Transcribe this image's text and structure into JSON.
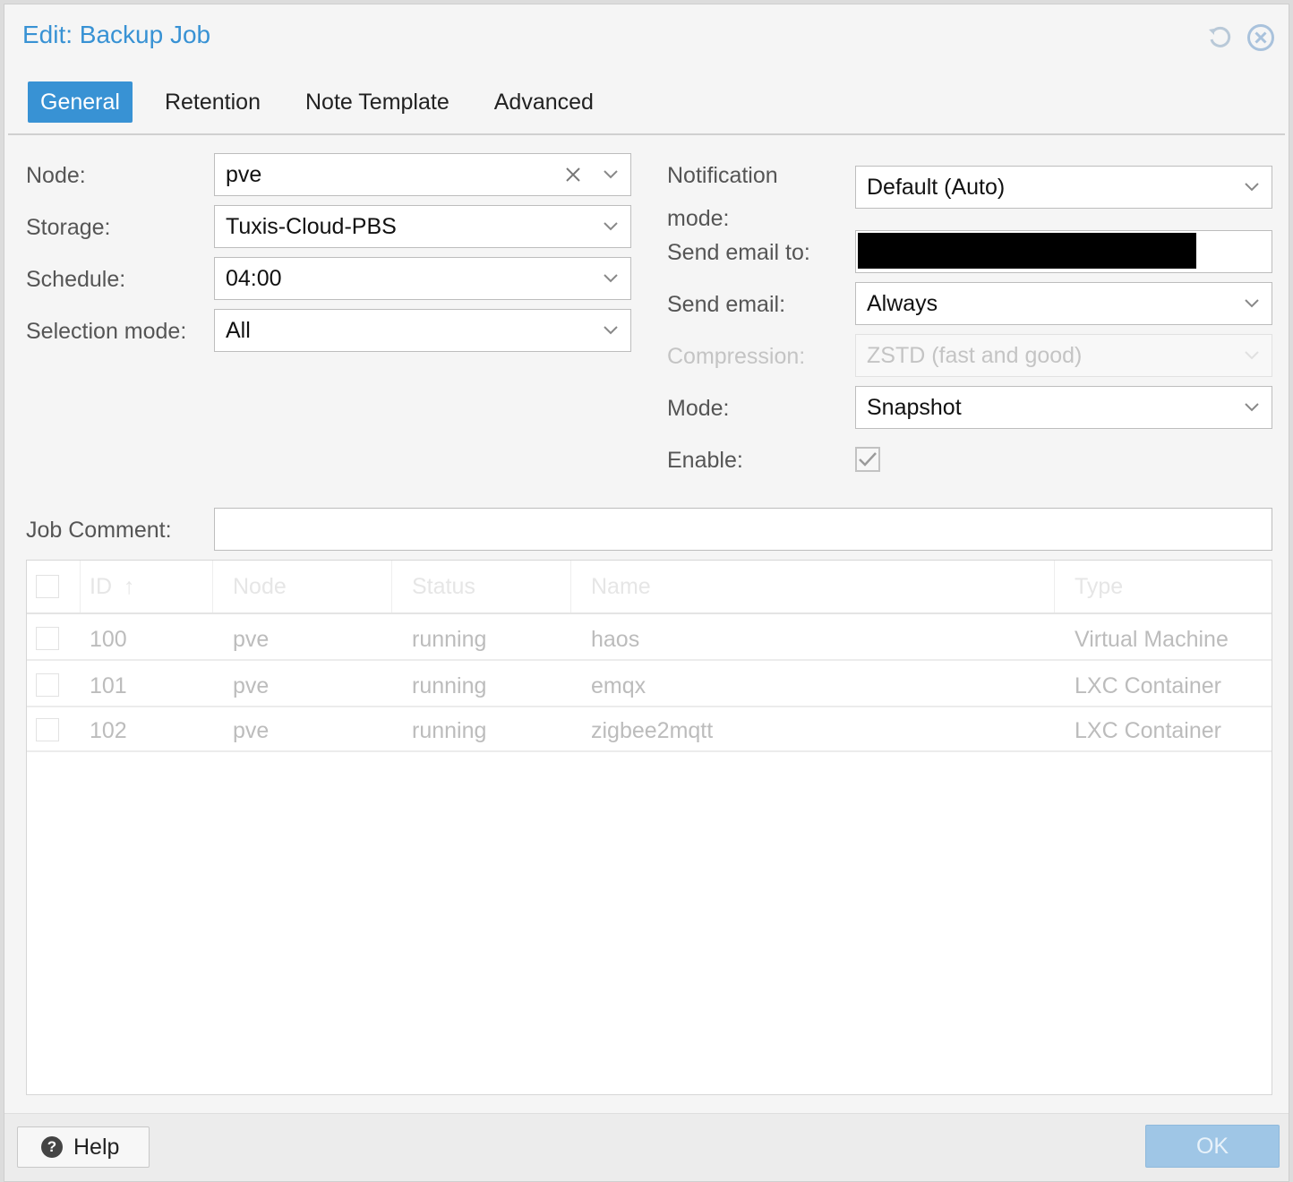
{
  "dialog": {
    "title": "Edit: Backup Job"
  },
  "tabs": [
    "General",
    "Retention",
    "Note Template",
    "Advanced"
  ],
  "left": {
    "node": {
      "label": "Node:",
      "value": "pve"
    },
    "storage": {
      "label": "Storage:",
      "value": "Tuxis-Cloud-PBS"
    },
    "schedule": {
      "label": "Schedule:",
      "value": "04:00"
    },
    "selection": {
      "label": "Selection mode:",
      "value": "All"
    }
  },
  "right": {
    "notification": {
      "label_line1": "Notification",
      "label_line2": "mode:",
      "value": "Default (Auto)"
    },
    "email_to": {
      "label": "Send email to:",
      "value": ""
    },
    "send_email": {
      "label": "Send email:",
      "value": "Always"
    },
    "compression": {
      "label": "Compression:",
      "value": "ZSTD (fast and good)"
    },
    "mode": {
      "label": "Mode:",
      "value": "Snapshot"
    },
    "enable": {
      "label": "Enable:",
      "checked": true
    }
  },
  "comment": {
    "label": "Job Comment:",
    "value": ""
  },
  "grid": {
    "columns": [
      "ID",
      "Node",
      "Status",
      "Name",
      "Type"
    ],
    "rows": [
      {
        "id": "100",
        "node": "pve",
        "status": "running",
        "name": "haos",
        "type": "Virtual Machine"
      },
      {
        "id": "101",
        "node": "pve",
        "status": "running",
        "name": "emqx",
        "type": "LXC Container"
      },
      {
        "id": "102",
        "node": "pve",
        "status": "running",
        "name": "zigbee2mqtt",
        "type": "LXC Container"
      }
    ]
  },
  "footer": {
    "help_label": "Help",
    "ok_label": "OK"
  },
  "colors": {
    "accent": "#3892d4",
    "ok_disabled": "#9fc6e6"
  }
}
